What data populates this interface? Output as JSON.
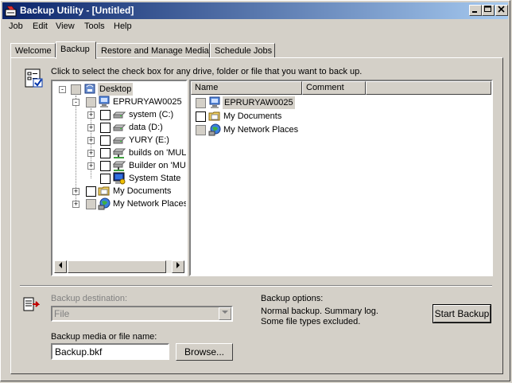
{
  "window": {
    "title": "Backup Utility - [Untitled]"
  },
  "menu": [
    "Job",
    "Edit",
    "View",
    "Tools",
    "Help"
  ],
  "tabs": [
    {
      "label": "Welcome",
      "active": false
    },
    {
      "label": "Backup",
      "active": true
    },
    {
      "label": "Restore and Manage Media",
      "active": false
    },
    {
      "label": "Schedule Jobs",
      "active": false
    }
  ],
  "instruction": "Click to select the check box for any drive, folder or file that you want to back up.",
  "tree": [
    {
      "label": "Desktop",
      "icon": "desktop-icon",
      "check": "gray",
      "expander": "-",
      "level": 0,
      "selected": true
    },
    {
      "label": "EPRURYAW0025",
      "icon": "computer-icon",
      "check": "gray",
      "expander": "-",
      "level": 1,
      "selected": false
    },
    {
      "label": "system (C:)",
      "icon": "drive-icon",
      "check": "empty",
      "expander": "+",
      "level": 2
    },
    {
      "label": "data (D:)",
      "icon": "drive-icon",
      "check": "empty",
      "expander": "+",
      "level": 2
    },
    {
      "label": "YURY (E:)",
      "icon": "drive-icon",
      "check": "empty",
      "expander": "+",
      "level": 2
    },
    {
      "label": "builds on 'MUL",
      "icon": "network-drive-icon",
      "check": "empty",
      "expander": "+",
      "level": 2
    },
    {
      "label": "Builder on 'MU",
      "icon": "network-drive-icon",
      "check": "empty",
      "expander": "+",
      "level": 2
    },
    {
      "label": "System State",
      "icon": "system-state-icon",
      "check": "empty",
      "expander": "",
      "level": 2
    },
    {
      "label": "My Documents",
      "icon": "folder-icon",
      "check": "empty",
      "expander": "+",
      "level": 1
    },
    {
      "label": "My Network Places",
      "icon": "network-places-icon",
      "check": "gray",
      "expander": "+",
      "level": 1
    }
  ],
  "list": {
    "columns": [
      "Name",
      "Comment"
    ],
    "items": [
      {
        "name": "EPRURYAW0025",
        "icon": "computer-icon",
        "check": "gray",
        "selected": true
      },
      {
        "name": "My Documents",
        "icon": "folder-icon",
        "check": "empty",
        "selected": false
      },
      {
        "name": "My Network Places",
        "icon": "network-places-icon",
        "check": "gray",
        "selected": false
      }
    ]
  },
  "bottom": {
    "destination_label": "Backup destination:",
    "destination_value": "File",
    "media_label": "Backup media or file name:",
    "media_value": "Backup.bkf",
    "browse_label": "Browse...",
    "options_label": "Backup options:",
    "options_line1": "Normal backup.  Summary log.",
    "options_line2": "Some file types excluded.",
    "start_label": "Start Backup"
  }
}
